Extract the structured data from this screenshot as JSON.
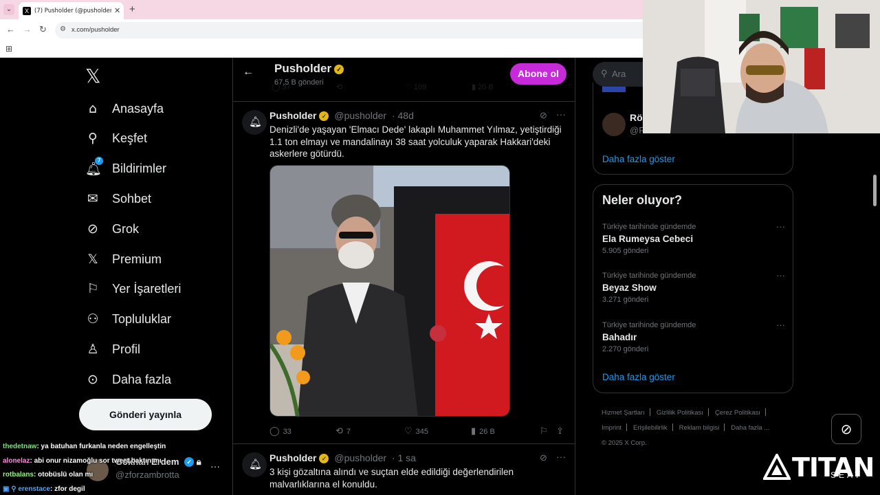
{
  "browser": {
    "tab_title": "(7) Pusholder (@pusholder) / X",
    "url": "x.com/pusholder",
    "tab_close": "✕",
    "new_tab": "+"
  },
  "nav": {
    "items": [
      {
        "label": "Anasayfa",
        "icon": "home-icon"
      },
      {
        "label": "Keşfet",
        "icon": "search-icon"
      },
      {
        "label": "Bildirimler",
        "icon": "bell-icon",
        "badge": "7"
      },
      {
        "label": "Sohbet",
        "icon": "mail-icon"
      },
      {
        "label": "Grok",
        "icon": "grok-icon"
      },
      {
        "label": "Premium",
        "icon": "x-icon"
      },
      {
        "label": "Yer İşaretleri",
        "icon": "bookmark-icon"
      },
      {
        "label": "Topluluklar",
        "icon": "communities-icon"
      },
      {
        "label": "Profil",
        "icon": "person-icon"
      },
      {
        "label": "Daha fazla",
        "icon": "more-circle-icon"
      }
    ],
    "post_button": "Gönderi yayınla",
    "account": {
      "name": "Gökhan Erdem",
      "handle": "@zforzambrotta"
    }
  },
  "profile": {
    "name": "Pusholder",
    "post_count": "67,5 B gönderi",
    "subscribe": "Abone ol"
  },
  "tweets": [
    {
      "author": "Pusholder",
      "handle": "@pusholder",
      "time": "· 48d",
      "text": "Denizli'de yaşayan 'Elmacı Dede' lakaplı Muhammet Yılmaz, yetiştirdiği 1.1 ton elmayı ve mandalinayı 38 saat yolculuk yaparak Hakkari'deki askerlere götürdü.",
      "replies": "33",
      "reposts": "7",
      "likes": "345",
      "views": "26 B"
    },
    {
      "author": "Pusholder",
      "handle": "@pusholder",
      "time": "· 1 sa",
      "text": "3 kişi gözaltına alındı ve suçtan elde edildiği değerlendirilen malvarlıklarına el konuldu."
    }
  ],
  "right": {
    "search_placeholder": "Ara",
    "recommend": {
      "name": "Rö",
      "handle": "@Ro"
    },
    "show_more": "Daha fazla göster",
    "trends_title": "Neler oluyor?",
    "trends": [
      {
        "context": "Türkiye tarihinde gündemde",
        "name": "Ela Rumeysa Cebeci",
        "count": "5.905 gönderi"
      },
      {
        "context": "Türkiye tarihinde gündemde",
        "name": "Beyaz Show",
        "count": "3.271 gönderi"
      },
      {
        "context": "Türkiye tarihinde gündemde",
        "name": "Bahadır",
        "count": "2.270 gönderi"
      }
    ],
    "footer": [
      "Hizmet Şartları",
      "Gizlilik Politikası",
      "Çerez Politikası",
      "Imprint",
      "Erişilebilirlik",
      "Reklam bilgisi",
      "Daha fazla ...",
      "© 2025 X Corp."
    ]
  },
  "chat": [
    {
      "user": "thedetnaw",
      "msg": ": ya batuhan furkanla neden engelleştin"
    },
    {
      "user": "alonelaz",
      "msg": ": abi onur nizamoğlu sor tweet baktın mı"
    },
    {
      "user": "rotbalans",
      "msg": ": otobüslü olan mı"
    },
    {
      "user": "erenstace",
      "msg": ": zfor degil"
    }
  ],
  "brand": {
    "name": "TITAN",
    "sub": "SEAT"
  }
}
